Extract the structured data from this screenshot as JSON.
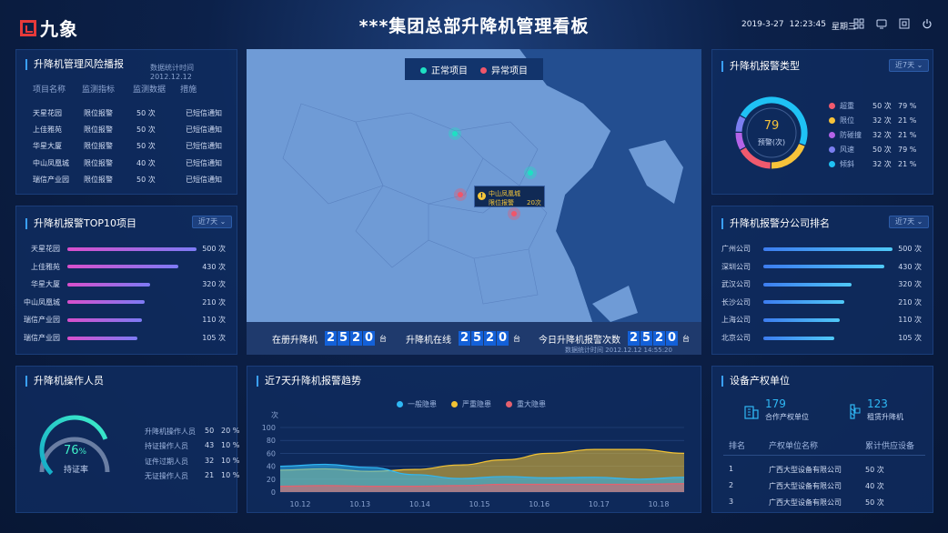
{
  "header": {
    "logo_text": "九象",
    "title": "***集团总部升降机管理看板",
    "date": "2019-3-27",
    "time": "12:23:45",
    "weekday": "星期三"
  },
  "risk_panel": {
    "title": "升降机管理风险播报",
    "note": "数据统计时间 2012.12.12",
    "headers": [
      "项目名称",
      "监测指标",
      "监测数据",
      "措施"
    ],
    "rows": [
      [
        "天星花园",
        "限位报警",
        "50 次",
        "已短信通知"
      ],
      [
        "上佳雅苑",
        "限位报警",
        "50 次",
        "已短信通知"
      ],
      [
        "华星大厦",
        "限位报警",
        "50 次",
        "已短信通知"
      ],
      [
        "中山凤凰城",
        "限位报警",
        "40 次",
        "已短信通知"
      ],
      [
        "瑞信产业园",
        "限位报警",
        "50 次",
        "已短信通知"
      ]
    ]
  },
  "top10_panel": {
    "title": "升降机报警TOP10项目",
    "select": "近7天",
    "items": [
      {
        "name": "天星花园",
        "value": "500 次",
        "fraction": 1.0
      },
      {
        "name": "上佳雅苑",
        "value": "430 次",
        "fraction": 0.86
      },
      {
        "name": "华星大厦",
        "value": "320 次",
        "fraction": 0.64
      },
      {
        "name": "中山凤凰城",
        "value": "210 次",
        "fraction": 0.6
      },
      {
        "name": "瑞信产业园",
        "value": "110 次",
        "fraction": 0.58
      },
      {
        "name": "瑞信产业园",
        "value": "105 次",
        "fraction": 0.54
      }
    ]
  },
  "operator_panel": {
    "title": "升降机操作人员",
    "gauge_value": "76",
    "gauge_unit": "%",
    "gauge_fraction": 0.76,
    "gauge_label": "持证率",
    "rows": [
      [
        "升降机操作人员",
        "50",
        "20 %"
      ],
      [
        "持证操作人员",
        "43",
        "10 %"
      ],
      [
        "证件过期人员",
        "32",
        "10 %"
      ],
      [
        "无证操作人员",
        "21",
        "10 %"
      ]
    ]
  },
  "map_panel": {
    "legend_normal": "正常项目",
    "legend_abnormal": "异常项目",
    "color_normal": "#1ee0c3",
    "color_abnormal": "#f0566a",
    "tooltip_title": "中山凤凰城",
    "tooltip_type": "限位报警",
    "tooltip_count": "20次",
    "stat1_label": "在册升降机",
    "stat2_label": "升降机在线",
    "stat3_label": "今日升降机报警次数",
    "stat_digits": [
      "2",
      "5",
      "2",
      "0"
    ],
    "stat_unit": "台",
    "note": "数据统计时间 2012.12.12   14:55:20"
  },
  "alarm_type_panel": {
    "title": "升降机报警类型",
    "select": "近7天",
    "center_value": "79",
    "center_label": "预警(次)",
    "items": [
      {
        "name": "超重",
        "value": "50 次",
        "pct": "79 %",
        "color": "#f05a6e"
      },
      {
        "name": "限位",
        "value": "32 次",
        "pct": "21 %",
        "color": "#f7c33a"
      },
      {
        "name": "防碰撞",
        "value": "32 次",
        "pct": "21 %",
        "color": "#b463e8"
      },
      {
        "name": "风速",
        "value": "50 次",
        "pct": "79 %",
        "color": "#7b7ef0"
      },
      {
        "name": "倾斜",
        "value": "32 次",
        "pct": "21 %",
        "color": "#1fc2f5"
      }
    ]
  },
  "company_panel": {
    "title": "升降机报警分公司排名",
    "select": "近7天",
    "items": [
      {
        "name": "广州公司",
        "value": "500 次",
        "fraction": 1.0
      },
      {
        "name": "深圳公司",
        "value": "430 次",
        "fraction": 0.94
      },
      {
        "name": "武汉公司",
        "value": "320 次",
        "fraction": 0.68
      },
      {
        "name": "长沙公司",
        "value": "210 次",
        "fraction": 0.63
      },
      {
        "name": "上海公司",
        "value": "110 次",
        "fraction": 0.59
      },
      {
        "name": "北京公司",
        "value": "105 次",
        "fraction": 0.55
      }
    ]
  },
  "owner_panel": {
    "title": "设备产权单位",
    "stat1_value": "179",
    "stat1_label": "合作产权单位",
    "stat2_value": "123",
    "stat2_label": "租赁升降机",
    "headers": [
      "排名",
      "产权单位名称",
      "累计供应设备"
    ],
    "rows": [
      [
        "1",
        "广西大型设备有限公司",
        "50 次"
      ],
      [
        "2",
        "广西大型设备有限公司",
        "40 次"
      ],
      [
        "3",
        "广西大型设备有限公司",
        "50 次"
      ]
    ]
  },
  "trend_panel": {
    "title": "近7天升降机报警趋势"
  },
  "chart_data": {
    "type": "area",
    "ylabel": "次",
    "ylim": [
      0,
      100
    ],
    "yticks": [
      "0",
      "20",
      "40",
      "60",
      "80",
      "100"
    ],
    "categories": [
      "10.12",
      "10.13",
      "10.14",
      "10.15",
      "10.16",
      "10.17",
      "10.18"
    ],
    "series": [
      {
        "name": "一般隐患",
        "color": "#2fb8f5",
        "values": [
          40,
          43,
          38,
          27,
          21,
          24,
          22,
          23,
          20,
          23
        ]
      },
      {
        "name": "严重隐患",
        "color": "#f2c233",
        "values": [
          34,
          36,
          32,
          35,
          42,
          50,
          60,
          66,
          66,
          60
        ]
      },
      {
        "name": "重大隐患",
        "color": "#e4606e",
        "values": [
          9,
          10,
          9,
          9,
          10,
          12,
          12,
          12,
          12,
          13
        ]
      }
    ],
    "grid": true,
    "legend": "top-center"
  }
}
